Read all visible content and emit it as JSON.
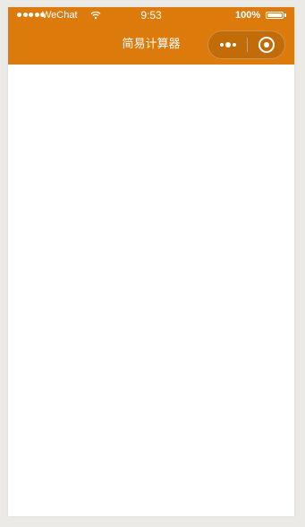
{
  "status_bar": {
    "carrier": "WeChat",
    "time": "9:53",
    "battery_percent": "100%",
    "battery_level": 1.0,
    "signal_bars": 5
  },
  "nav_bar": {
    "title": "简易计算器",
    "background_color": "#dc7a0b",
    "capsule_icons": [
      "more-icon",
      "close-target-icon"
    ]
  }
}
